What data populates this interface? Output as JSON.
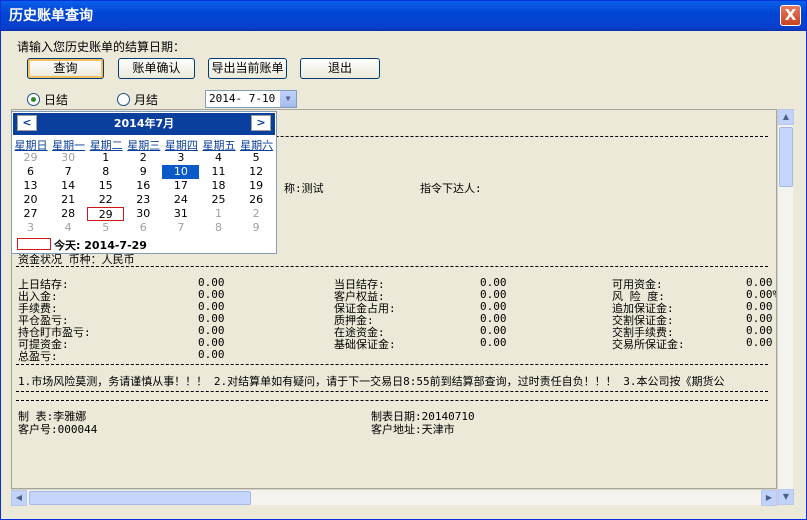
{
  "window": {
    "title": "历史账单查询",
    "close": "X"
  },
  "prompt": "请输入您历史账单的结算日期：",
  "buttons": {
    "query": "查询",
    "confirm": "账单确认",
    "export": "导出当前账单",
    "exit": "退出"
  },
  "radios": {
    "daily": "日结",
    "monthly": "月结"
  },
  "date_value": "2014- 7-10",
  "calendar": {
    "title": "2014年7月",
    "weekdays": [
      "星期日",
      "星期一",
      "星期二",
      "星期三",
      "星期四",
      "星期五",
      "星期六"
    ],
    "rows": [
      [
        "29",
        "30",
        "1",
        "2",
        "3",
        "4",
        "5"
      ],
      [
        "6",
        "7",
        "8",
        "9",
        "10",
        "11",
        "12"
      ],
      [
        "13",
        "14",
        "15",
        "16",
        "17",
        "18",
        "19"
      ],
      [
        "20",
        "21",
        "22",
        "23",
        "24",
        "25",
        "26"
      ],
      [
        "27",
        "28",
        "29",
        "30",
        "31",
        "1",
        "2"
      ],
      [
        "3",
        "4",
        "5",
        "6",
        "7",
        "8",
        "9"
      ]
    ],
    "today_label": "今天: 2014-7-29"
  },
  "report": {
    "name_fragment": "称:测试",
    "instructor_label": "指令下达人:",
    "fund_status": "资金状况  币种：人民币",
    "col1": [
      [
        "上日结存:",
        "0.00"
      ],
      [
        "出入金:",
        "0.00"
      ],
      [
        "手续费:",
        "0.00"
      ],
      [
        "平仓盈亏:",
        "0.00"
      ],
      [
        "持仓盯市盈亏:",
        "0.00"
      ],
      [
        "可提资金:",
        "0.00"
      ],
      [
        "总盈亏:",
        "0.00"
      ]
    ],
    "col2": [
      [
        "当日结存:",
        "0.00"
      ],
      [
        "客户权益:",
        "0.00"
      ],
      [
        "保证金占用:",
        "0.00"
      ],
      [
        "质押金:",
        "0.00"
      ],
      [
        "在途资金:",
        "0.00"
      ],
      [
        "基础保证金:",
        "0.00"
      ]
    ],
    "col3": [
      [
        "可用资金:",
        "0.00"
      ],
      [
        "风 险 度:",
        "0.00%"
      ],
      [
        "追加保证金:",
        "0.00"
      ],
      [
        "交割保证金:",
        "0.00"
      ],
      [
        "交割手续费:",
        "0.00"
      ],
      [
        "交易所保证金:",
        "0.00"
      ]
    ],
    "notice": "1.市场风险莫测，务请谨慎从事！！！ 2.对结算单如有疑问，请于下一交易日8:55前到结算部查询，过时责任自负！！！ 3.本公司按《期货公",
    "maker": "制  表:李雅娜",
    "date_made": "制表日期:20140710",
    "client_no": "客户号:000044",
    "client_addr": "客户地址:天津市"
  }
}
